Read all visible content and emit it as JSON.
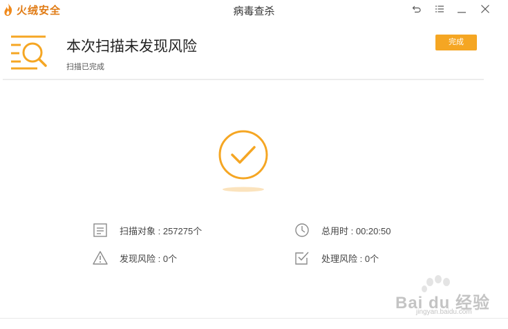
{
  "titlebar": {
    "brand": "火绒安全",
    "title": "病毒查杀"
  },
  "header": {
    "headline": "本次扫描未发现风险",
    "subline": "扫描已完成",
    "done_button": "完成"
  },
  "stats": {
    "scan_objects": "扫描对象 : 257275个",
    "total_time": "总用时 : 00:20:50",
    "risks_found": "发现风险 : 0个",
    "risks_handled": "处理风险 : 0个"
  },
  "watermark": {
    "text": "Bai du 经验",
    "url": "jingyan.baidu.com"
  },
  "colors": {
    "accent": "#f5a623",
    "brand": "#e07b14"
  }
}
